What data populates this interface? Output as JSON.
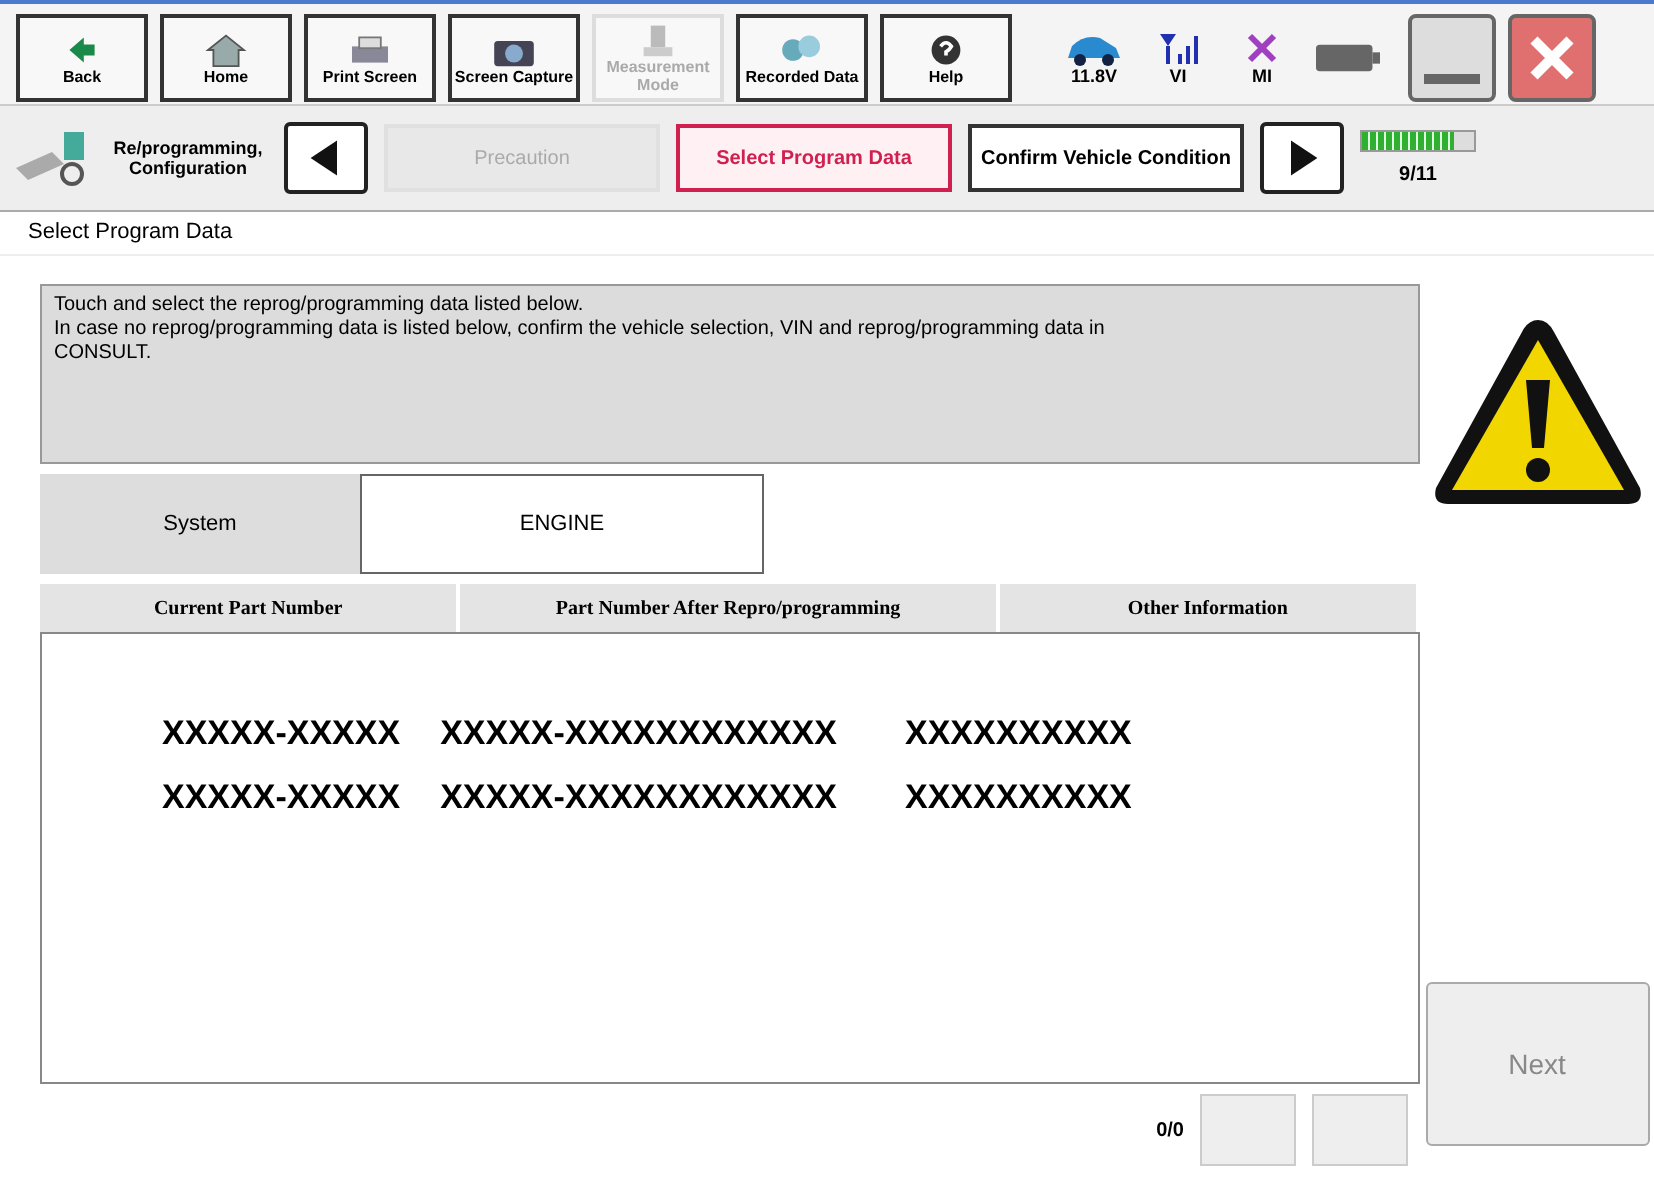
{
  "toolbar": {
    "buttons": [
      {
        "kind": "back",
        "label": "Back",
        "disabled": false
      },
      {
        "kind": "home",
        "label": "Home",
        "disabled": false
      },
      {
        "kind": "print",
        "label": "Print Screen",
        "disabled": false
      },
      {
        "kind": "camera",
        "label": "Screen Capture",
        "disabled": false
      },
      {
        "kind": "measure",
        "label": "Measurement Mode",
        "disabled": true
      },
      {
        "kind": "recorded",
        "label": "Recorded Data",
        "disabled": false
      },
      {
        "kind": "help",
        "label": "Help",
        "disabled": false
      }
    ],
    "status": [
      {
        "kind": "car",
        "label": "11.8V"
      },
      {
        "kind": "signal",
        "label": "VI"
      },
      {
        "kind": "cross",
        "label": "MI"
      }
    ]
  },
  "breadcrumb": {
    "title": "Re/programming, Configuration",
    "steps": [
      {
        "label": "Precaution",
        "selected": false,
        "disabled": true
      },
      {
        "label": "Select Program Data",
        "selected": true,
        "disabled": false
      },
      {
        "label": "Confirm Vehicle Condition",
        "selected": false,
        "disabled": false
      }
    ],
    "progress": {
      "level": 0.82,
      "label": "9/11"
    }
  },
  "page_title": "Select Program Data",
  "message": "Touch and select the reprog/programming data listed below.\nIn case no reprog/programming data is listed below, confirm the vehicle selection, VIN and reprog/programming data in CONSULT.",
  "system": {
    "label": "System",
    "value": "ENGINE"
  },
  "table": {
    "columns": [
      "Current Part Number",
      "Part Number After Repro/programming",
      "Other Information"
    ],
    "rows": [
      [
        "XXXXX-XXXXX",
        "XXXXX-XXXXXXXXXXXX",
        "XXXXXXXXXX"
      ],
      [
        "XXXXX-XXXXX",
        "XXXXX-XXXXXXXXXXXX",
        "XXXXXXXXXX"
      ]
    ]
  },
  "pager": "0/0",
  "next_button": {
    "label": "Next",
    "disabled": true
  }
}
